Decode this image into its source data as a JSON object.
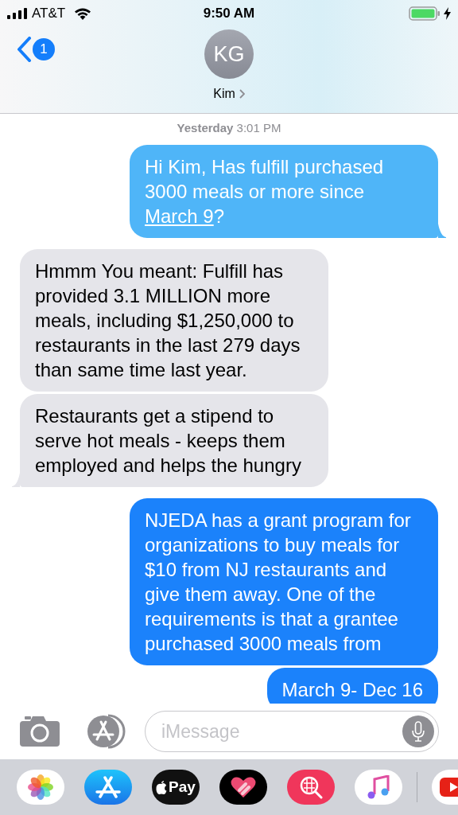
{
  "status_bar": {
    "carrier": "AT&T",
    "time": "9:50 AM"
  },
  "header": {
    "unread_count": "1",
    "avatar_initials": "KG",
    "contact_name": "Kim"
  },
  "timestamp": {
    "day": "Yesterday",
    "time": "3:01 PM"
  },
  "messages": [
    {
      "kind": "sent",
      "text": "Hi Kim, Has fulfill purchased 3000 meals or more since ",
      "link": "March 9",
      "text_after": "?",
      "tail": true
    },
    {
      "kind": "received",
      "text": "Hmmm You meant: Fulfill has provided 3.1 MILLION more meals, including $1,250,000 to restaurants in the last 279 days than same time last year.",
      "tail": false
    },
    {
      "kind": "received",
      "text": "Restaurants get a stipend to serve hot meals - keeps them employed and helps the hungry",
      "tail": true
    },
    {
      "kind": "sent",
      "text": "NJEDA has a grant program for organizations to buy meals for $10 from NJ restaurants and give them away. One of the requirements is that a grantee purchased 3000 meals from",
      "tail": false
    },
    {
      "kind": "sent",
      "text": "March 9- Dec 16"
    }
  ],
  "composer": {
    "placeholder": "iMessage"
  },
  "app_drawer": {
    "pay_label": "Pay"
  }
}
